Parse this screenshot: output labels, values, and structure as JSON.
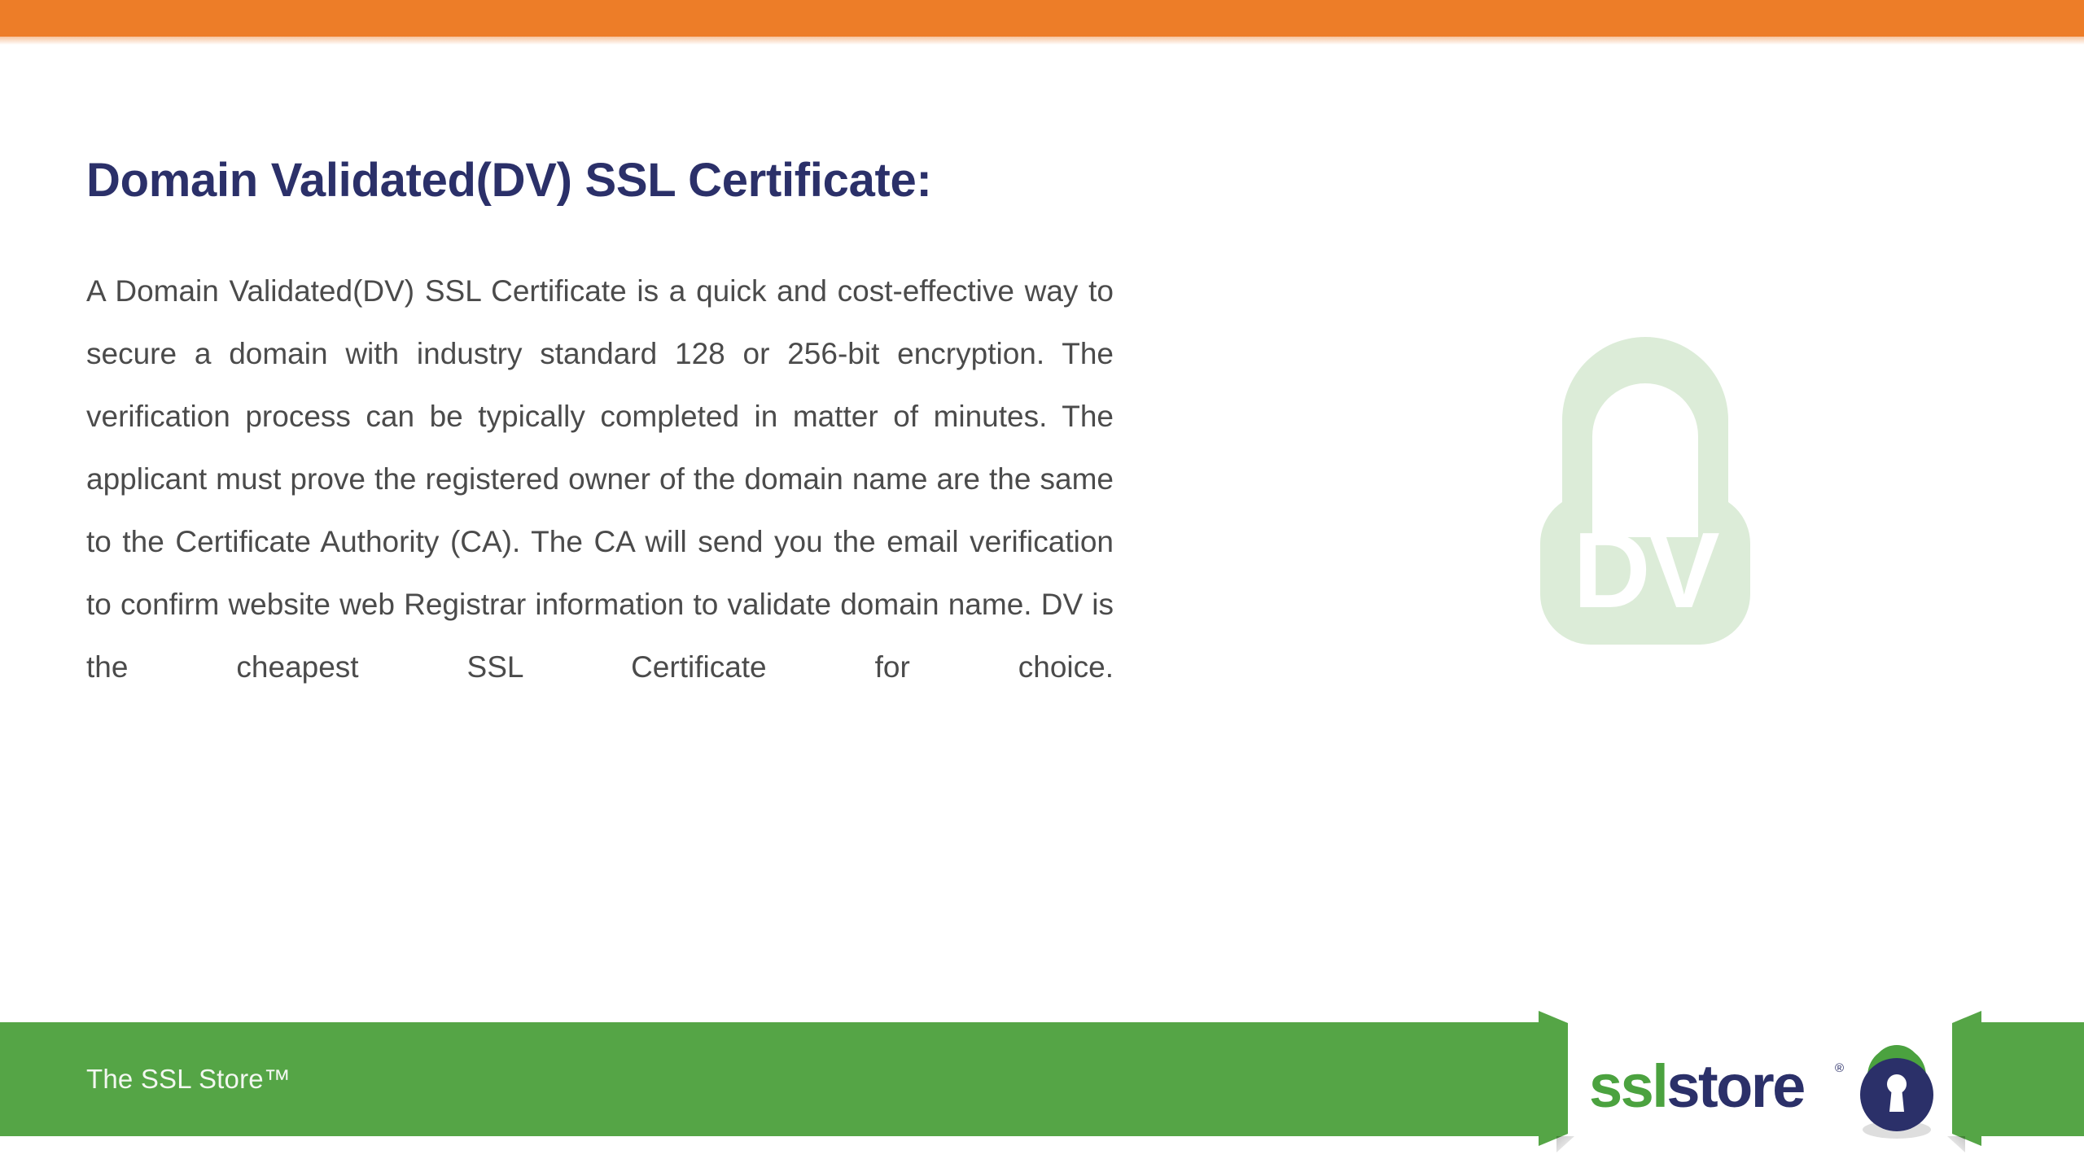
{
  "slide": {
    "title": "Domain Validated(DV) SSL Certificate:",
    "body": "A Domain Validated(DV) SSL Certificate is a quick and cost-effective way to secure a domain with industry standard 128 or 256-bit encryption. The verification process can be typically completed in matter of minutes. The applicant must prove the registered owner of the domain name are the same to the Certificate Authority (CA). The CA will send you the email verification to confirm website web Registrar information to validate domain name. DV is the cheapest SSL Certificate for choice."
  },
  "watermark": {
    "label": "DV",
    "icon": "padlock-dv-icon",
    "color": "#dcecd8"
  },
  "footer": {
    "label": "The SSL Store™",
    "brand": {
      "part_green": "ssl",
      "part_navy": "store",
      "trademark": "®",
      "icon": "padlock-keyhole-icon"
    }
  },
  "colors": {
    "top_bar_orange": "#ed7d28",
    "title_navy": "#2b3069",
    "body_gray": "#4b4b4b",
    "footer_green": "#55a546",
    "brand_green": "#4ba23f",
    "brand_navy": "#2b3069",
    "watermark_green": "#dcecd8"
  }
}
